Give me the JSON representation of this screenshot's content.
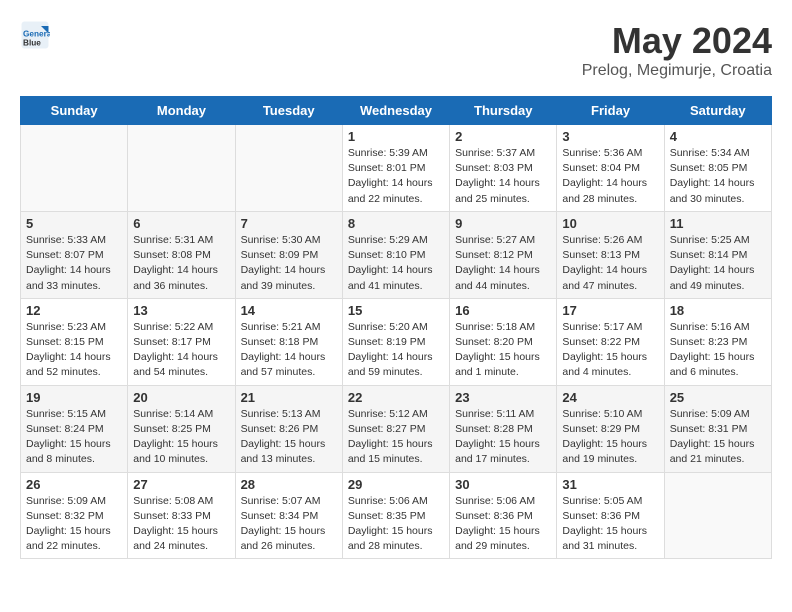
{
  "header": {
    "logo_line1": "General",
    "logo_line2": "Blue",
    "month_title": "May 2024",
    "location": "Prelog, Megimurje, Croatia"
  },
  "weekdays": [
    "Sunday",
    "Monday",
    "Tuesday",
    "Wednesday",
    "Thursday",
    "Friday",
    "Saturday"
  ],
  "weeks": [
    [
      {
        "day": "",
        "info": ""
      },
      {
        "day": "",
        "info": ""
      },
      {
        "day": "",
        "info": ""
      },
      {
        "day": "1",
        "info": "Sunrise: 5:39 AM\nSunset: 8:01 PM\nDaylight: 14 hours\nand 22 minutes."
      },
      {
        "day": "2",
        "info": "Sunrise: 5:37 AM\nSunset: 8:03 PM\nDaylight: 14 hours\nand 25 minutes."
      },
      {
        "day": "3",
        "info": "Sunrise: 5:36 AM\nSunset: 8:04 PM\nDaylight: 14 hours\nand 28 minutes."
      },
      {
        "day": "4",
        "info": "Sunrise: 5:34 AM\nSunset: 8:05 PM\nDaylight: 14 hours\nand 30 minutes."
      }
    ],
    [
      {
        "day": "5",
        "info": "Sunrise: 5:33 AM\nSunset: 8:07 PM\nDaylight: 14 hours\nand 33 minutes."
      },
      {
        "day": "6",
        "info": "Sunrise: 5:31 AM\nSunset: 8:08 PM\nDaylight: 14 hours\nand 36 minutes."
      },
      {
        "day": "7",
        "info": "Sunrise: 5:30 AM\nSunset: 8:09 PM\nDaylight: 14 hours\nand 39 minutes."
      },
      {
        "day": "8",
        "info": "Sunrise: 5:29 AM\nSunset: 8:10 PM\nDaylight: 14 hours\nand 41 minutes."
      },
      {
        "day": "9",
        "info": "Sunrise: 5:27 AM\nSunset: 8:12 PM\nDaylight: 14 hours\nand 44 minutes."
      },
      {
        "day": "10",
        "info": "Sunrise: 5:26 AM\nSunset: 8:13 PM\nDaylight: 14 hours\nand 47 minutes."
      },
      {
        "day": "11",
        "info": "Sunrise: 5:25 AM\nSunset: 8:14 PM\nDaylight: 14 hours\nand 49 minutes."
      }
    ],
    [
      {
        "day": "12",
        "info": "Sunrise: 5:23 AM\nSunset: 8:15 PM\nDaylight: 14 hours\nand 52 minutes."
      },
      {
        "day": "13",
        "info": "Sunrise: 5:22 AM\nSunset: 8:17 PM\nDaylight: 14 hours\nand 54 minutes."
      },
      {
        "day": "14",
        "info": "Sunrise: 5:21 AM\nSunset: 8:18 PM\nDaylight: 14 hours\nand 57 minutes."
      },
      {
        "day": "15",
        "info": "Sunrise: 5:20 AM\nSunset: 8:19 PM\nDaylight: 14 hours\nand 59 minutes."
      },
      {
        "day": "16",
        "info": "Sunrise: 5:18 AM\nSunset: 8:20 PM\nDaylight: 15 hours\nand 1 minute."
      },
      {
        "day": "17",
        "info": "Sunrise: 5:17 AM\nSunset: 8:22 PM\nDaylight: 15 hours\nand 4 minutes."
      },
      {
        "day": "18",
        "info": "Sunrise: 5:16 AM\nSunset: 8:23 PM\nDaylight: 15 hours\nand 6 minutes."
      }
    ],
    [
      {
        "day": "19",
        "info": "Sunrise: 5:15 AM\nSunset: 8:24 PM\nDaylight: 15 hours\nand 8 minutes."
      },
      {
        "day": "20",
        "info": "Sunrise: 5:14 AM\nSunset: 8:25 PM\nDaylight: 15 hours\nand 10 minutes."
      },
      {
        "day": "21",
        "info": "Sunrise: 5:13 AM\nSunset: 8:26 PM\nDaylight: 15 hours\nand 13 minutes."
      },
      {
        "day": "22",
        "info": "Sunrise: 5:12 AM\nSunset: 8:27 PM\nDaylight: 15 hours\nand 15 minutes."
      },
      {
        "day": "23",
        "info": "Sunrise: 5:11 AM\nSunset: 8:28 PM\nDaylight: 15 hours\nand 17 minutes."
      },
      {
        "day": "24",
        "info": "Sunrise: 5:10 AM\nSunset: 8:29 PM\nDaylight: 15 hours\nand 19 minutes."
      },
      {
        "day": "25",
        "info": "Sunrise: 5:09 AM\nSunset: 8:31 PM\nDaylight: 15 hours\nand 21 minutes."
      }
    ],
    [
      {
        "day": "26",
        "info": "Sunrise: 5:09 AM\nSunset: 8:32 PM\nDaylight: 15 hours\nand 22 minutes."
      },
      {
        "day": "27",
        "info": "Sunrise: 5:08 AM\nSunset: 8:33 PM\nDaylight: 15 hours\nand 24 minutes."
      },
      {
        "day": "28",
        "info": "Sunrise: 5:07 AM\nSunset: 8:34 PM\nDaylight: 15 hours\nand 26 minutes."
      },
      {
        "day": "29",
        "info": "Sunrise: 5:06 AM\nSunset: 8:35 PM\nDaylight: 15 hours\nand 28 minutes."
      },
      {
        "day": "30",
        "info": "Sunrise: 5:06 AM\nSunset: 8:36 PM\nDaylight: 15 hours\nand 29 minutes."
      },
      {
        "day": "31",
        "info": "Sunrise: 5:05 AM\nSunset: 8:36 PM\nDaylight: 15 hours\nand 31 minutes."
      },
      {
        "day": "",
        "info": ""
      }
    ]
  ]
}
